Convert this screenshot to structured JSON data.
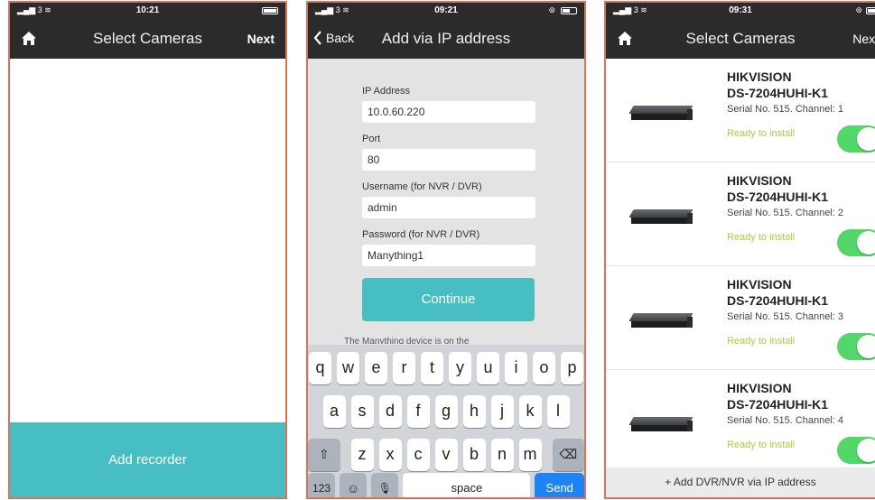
{
  "screen1": {
    "status": {
      "signal": "3",
      "time": "10:21"
    },
    "nav": {
      "title": "Select Cameras",
      "right": "Next"
    },
    "add_recorder": "Add recorder"
  },
  "screen2": {
    "status": {
      "signal": "3",
      "time": "09:21"
    },
    "nav": {
      "back": "Back",
      "title": "Add via IP address"
    },
    "fields": [
      {
        "label": "IP Address",
        "value": "10.0.60.220"
      },
      {
        "label": "Port",
        "value": "80"
      },
      {
        "label": "Username (for NVR / DVR)",
        "value": "admin"
      },
      {
        "label": "Password (for NVR / DVR)",
        "value": "Manything1"
      }
    ],
    "continue": "Continue",
    "partial_text": "The Manything device is on the",
    "keyboard": {
      "row1": [
        "q",
        "w",
        "e",
        "r",
        "t",
        "y",
        "u",
        "i",
        "o",
        "p"
      ],
      "row2": [
        "a",
        "s",
        "d",
        "f",
        "g",
        "h",
        "j",
        "k",
        "l"
      ],
      "row3": [
        "z",
        "x",
        "c",
        "v",
        "b",
        "n",
        "m"
      ],
      "shift": "⇧",
      "delete": "⌫",
      "num": "123",
      "emoji": "☺",
      "mic": "🎙",
      "space": "space",
      "send": "Send"
    }
  },
  "screen3": {
    "status": {
      "signal": "3",
      "time": "09:31"
    },
    "nav": {
      "title": "Select Cameras",
      "right": "Next"
    },
    "devices": [
      {
        "brand": "HIKVISION",
        "model": "DS-7204HUHI-K1",
        "serial": "Serial No. 515. Channel: 1",
        "status": "Ready to install",
        "enabled": true
      },
      {
        "brand": "HIKVISION",
        "model": "DS-7204HUHI-K1",
        "serial": "Serial No. 515. Channel: 2",
        "status": "Ready to install",
        "enabled": true
      },
      {
        "brand": "HIKVISION",
        "model": "DS-7204HUHI-K1",
        "serial": "Serial No. 515. Channel: 3",
        "status": "Ready to install",
        "enabled": true
      },
      {
        "brand": "HIKVISION",
        "model": "DS-7204HUHI-K1",
        "serial": "Serial No. 515. Channel: 4",
        "status": "Ready to install",
        "enabled": true
      }
    ],
    "add_ip": "+ Add DVR/NVR via IP address"
  },
  "colors": {
    "accent": "#47bfc2",
    "bar": "#2b2b2b",
    "toggle_on": "#53d769",
    "ready": "#a7cf45",
    "border": "#e0705a"
  },
  "icons": {
    "home": "home-icon",
    "back": "chevron-left-icon",
    "signal": "signal-icon",
    "battery": "battery-icon"
  }
}
